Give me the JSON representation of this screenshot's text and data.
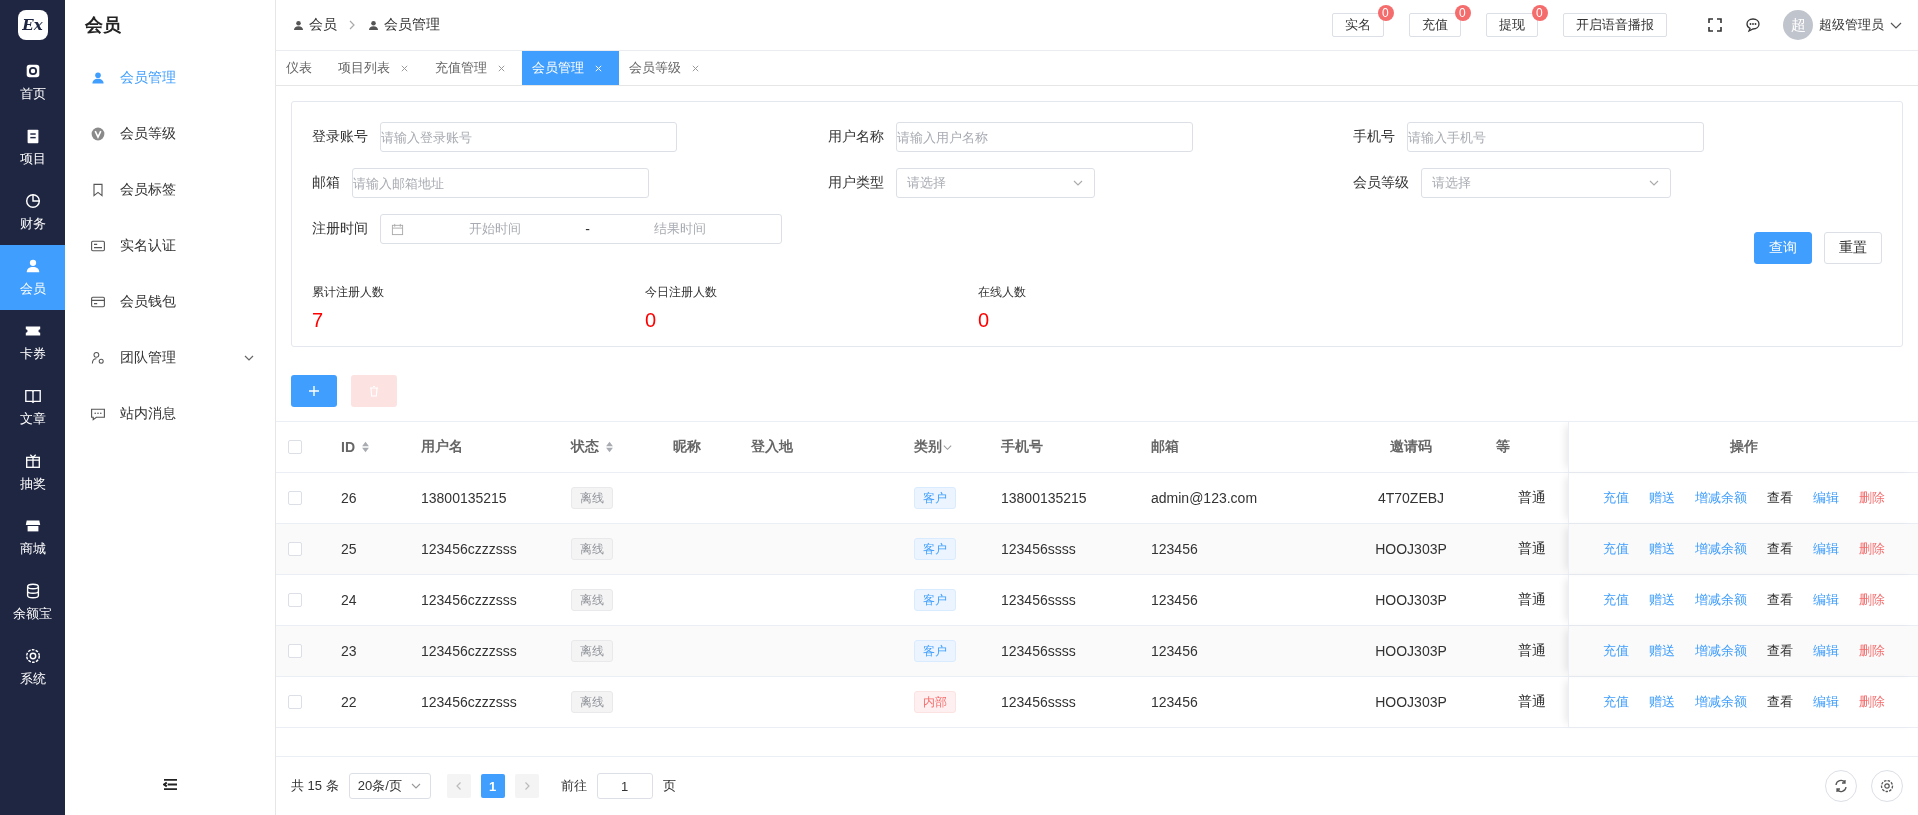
{
  "rail": {
    "logo": "Ex",
    "items": [
      {
        "label": "首页",
        "selected": false
      },
      {
        "label": "项目",
        "selected": false
      },
      {
        "label": "财务",
        "selected": false
      },
      {
        "label": "会员",
        "selected": true
      },
      {
        "label": "卡券",
        "selected": false
      },
      {
        "label": "文章",
        "selected": false
      },
      {
        "label": "抽奖",
        "selected": false
      },
      {
        "label": "商城",
        "selected": false
      },
      {
        "label": "余额宝",
        "selected": false
      },
      {
        "label": "系统",
        "selected": false
      }
    ]
  },
  "sidebar": {
    "title": "会员",
    "items": [
      {
        "label": "会员管理",
        "selected": true
      },
      {
        "label": "会员等级",
        "selected": false
      },
      {
        "label": "会员标签",
        "selected": false
      },
      {
        "label": "实名认证",
        "selected": false
      },
      {
        "label": "会员钱包",
        "selected": false
      },
      {
        "label": "团队管理",
        "selected": false,
        "expanded": false
      },
      {
        "label": "站内消息",
        "selected": false
      }
    ]
  },
  "breadcrumb": [
    "会员",
    "会员管理"
  ],
  "header": {
    "counters": [
      {
        "label": "实名",
        "badge": "0"
      },
      {
        "label": "充值",
        "badge": "0"
      },
      {
        "label": "提现",
        "badge": "0"
      }
    ],
    "voice_button": "开启语音播报",
    "avatar": "超",
    "user": "超级管理员"
  },
  "tabs": [
    {
      "label": "仪表",
      "selected": false,
      "closable": false
    },
    {
      "label": "项目列表",
      "selected": false,
      "closable": true
    },
    {
      "label": "充值管理",
      "selected": false,
      "closable": true
    },
    {
      "label": "会员管理",
      "selected": true,
      "closable": true
    },
    {
      "label": "会员等级",
      "selected": false,
      "closable": true
    }
  ],
  "filters": [
    {
      "label": "登录账号",
      "kind": "input",
      "placeholder": "请输入登录账号"
    },
    {
      "label": "用户名称",
      "kind": "input",
      "placeholder": "请输入用户名称"
    },
    {
      "label": "手机号",
      "kind": "input",
      "placeholder": "请输入手机号"
    },
    {
      "label": "邮箱",
      "kind": "input",
      "placeholder": "请输入邮箱地址"
    },
    {
      "label": "用户类型",
      "kind": "select",
      "placeholder": "请选择"
    },
    {
      "label": "会员等级",
      "kind": "select",
      "placeholder": "请选择"
    },
    {
      "label": "注册时间",
      "kind": "daterange",
      "start_placeholder": "开始时间",
      "separator": "-",
      "end_placeholder": "结果时间"
    }
  ],
  "filter_buttons": {
    "search": "查询",
    "reset": "重置"
  },
  "stats": [
    {
      "label": "累计注册人数",
      "value": "7"
    },
    {
      "label": "今日注册人数",
      "value": "0"
    },
    {
      "label": "在线人数",
      "value": "0"
    }
  ],
  "toolbar": {
    "delete_disabled": true
  },
  "table": {
    "all_checked": false,
    "columns": [
      {
        "label": "ID",
        "kind": "sortable"
      },
      {
        "label": "用户名",
        "kind": "plain"
      },
      {
        "label": "状态",
        "kind": "sortable"
      },
      {
        "label": "昵称",
        "kind": "plain"
      },
      {
        "label": "登入地",
        "kind": "plain"
      },
      {
        "label": "类别",
        "kind": "filterable"
      },
      {
        "label": "手机号",
        "kind": "plain"
      },
      {
        "label": "邮箱",
        "kind": "plain"
      },
      {
        "label": "邀请码",
        "kind": "plain"
      },
      {
        "label": "等",
        "kind": "plain"
      },
      {
        "label": "操作",
        "kind": "plain"
      }
    ],
    "rows": [
      {
        "checked": false,
        "id": "26",
        "username": "13800135215",
        "status": "离线",
        "category": {
          "label": "客户",
          "kind": "customer"
        },
        "phone": "13800135215",
        "email": "admin@123.com",
        "invite_code": "4T70ZEBJ",
        "member_level": "普通",
        "actions": [
          {
            "label": "充值",
            "kind": "primary"
          },
          {
            "label": "赠送",
            "kind": "primary"
          },
          {
            "label": "增减余额",
            "kind": "primary"
          },
          {
            "label": "查看",
            "kind": "plain"
          },
          {
            "label": "编辑",
            "kind": "primary"
          },
          {
            "label": "删除",
            "kind": "danger"
          }
        ]
      },
      {
        "checked": false,
        "id": "25",
        "username": "123456czzzsss",
        "status": "离线",
        "category": {
          "label": "客户",
          "kind": "customer"
        },
        "phone": "123456ssss",
        "email": "123456",
        "invite_code": "HOOJ303P",
        "member_level": "普通",
        "actions": [
          {
            "label": "充值",
            "kind": "primary"
          },
          {
            "label": "赠送",
            "kind": "primary"
          },
          {
            "label": "增减余额",
            "kind": "primary"
          },
          {
            "label": "查看",
            "kind": "plain"
          },
          {
            "label": "编辑",
            "kind": "primary"
          },
          {
            "label": "删除",
            "kind": "danger"
          }
        ]
      },
      {
        "checked": false,
        "id": "24",
        "username": "123456czzzsss",
        "status": "离线",
        "category": {
          "label": "客户",
          "kind": "customer"
        },
        "phone": "123456ssss",
        "email": "123456",
        "invite_code": "HOOJ303P",
        "member_level": "普通",
        "actions": [
          {
            "label": "充值",
            "kind": "primary"
          },
          {
            "label": "赠送",
            "kind": "primary"
          },
          {
            "label": "增减余额",
            "kind": "primary"
          },
          {
            "label": "查看",
            "kind": "plain"
          },
          {
            "label": "编辑",
            "kind": "primary"
          },
          {
            "label": "删除",
            "kind": "danger"
          }
        ]
      },
      {
        "checked": false,
        "id": "23",
        "username": "123456czzzsss",
        "status": "离线",
        "category": {
          "label": "客户",
          "kind": "customer"
        },
        "phone": "123456ssss",
        "email": "123456",
        "invite_code": "HOOJ303P",
        "member_level": "普通",
        "actions": [
          {
            "label": "充值",
            "kind": "primary"
          },
          {
            "label": "赠送",
            "kind": "primary"
          },
          {
            "label": "增减余额",
            "kind": "primary"
          },
          {
            "label": "查看",
            "kind": "plain"
          },
          {
            "label": "编辑",
            "kind": "primary"
          },
          {
            "label": "删除",
            "kind": "danger"
          }
        ]
      },
      {
        "checked": false,
        "id": "22",
        "username": "123456czzzsss",
        "status": "离线",
        "category": {
          "label": "内部",
          "kind": "internal"
        },
        "phone": "123456ssss",
        "email": "123456",
        "invite_code": "HOOJ303P",
        "member_level": "普通",
        "actions": [
          {
            "label": "充值",
            "kind": "primary"
          },
          {
            "label": "赠送",
            "kind": "primary"
          },
          {
            "label": "增减余额",
            "kind": "primary"
          },
          {
            "label": "查看",
            "kind": "plain"
          },
          {
            "label": "编辑",
            "kind": "primary"
          },
          {
            "label": "删除",
            "kind": "danger"
          }
        ]
      }
    ]
  },
  "pagination": {
    "total": "共 15 条",
    "page_size": "20条/页",
    "pages": [
      {
        "label": "1",
        "selected": true
      }
    ],
    "goto_label": "前往",
    "goto_value": "1",
    "page_suffix": "页"
  }
}
